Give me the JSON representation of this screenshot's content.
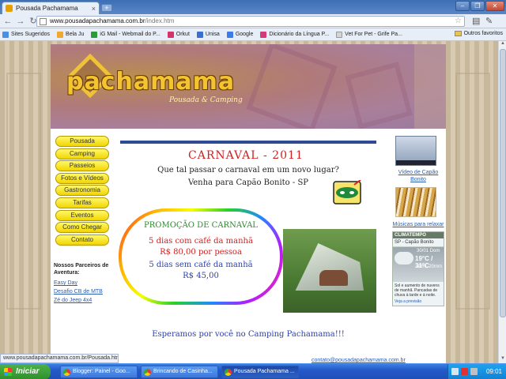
{
  "browser": {
    "tab_title": "Pousada Pachamama",
    "url_host": "www.pousadapachamama.com.br",
    "url_path": "/index.htm",
    "bookmarks": [
      {
        "label": "Sites Sugeridos",
        "color": "#4a8fe0"
      },
      {
        "label": "Bela Ju",
        "color": "#f0a830"
      },
      {
        "label": "iG Mail - Webmail do P...",
        "color": "#2a9a3a"
      },
      {
        "label": "Orkut",
        "color": "#d6336c"
      },
      {
        "label": "Unisa",
        "color": "#3a6fd0"
      },
      {
        "label": "Google",
        "color": "#3c7be8"
      },
      {
        "label": "Dicionário da Língua P...",
        "color": "#d43a7a"
      },
      {
        "label": "Vet For Pet - Grife Pa...",
        "color": "#d4d4d4"
      }
    ],
    "other_bookmarks": "Outros favoritos",
    "status_url": "www.pousadapachamama.com.br/Pousada.htm"
  },
  "site": {
    "logo": "pachamama",
    "logo_sub": "Pousada & Camping",
    "nav": [
      "Pousada",
      "Camping",
      "Passeios",
      "Fotos e Vídeos",
      "Gastronomia",
      "Tarifas",
      "Eventos",
      "Como Chegar",
      "Contato"
    ],
    "partners_heading": "Nossos Parceiros de Aventura:",
    "partners": [
      "Easy Day",
      "Desafio CB de MTB",
      "Zé do Jeep 4x4"
    ],
    "poster": {
      "title": "CARNAVAL - 2011",
      "line1": "Que tal passar o carnaval em um novo lugar?",
      "line2": "Venha para Capão Bonito - SP",
      "promo": "PROMOÇÃO DE CARNAVAL",
      "offer1": "5 dias com café da manhã",
      "price1": "R$ 80,00 por pessoa",
      "offer2": "5 dias sem café da manhã",
      "price2": "R$ 45,00",
      "bottom": "Esperamos por você no Camping Pachamama!!!"
    },
    "video_link": "Vídeo de Capão Bonito",
    "music_link": "Músicas para relaxar",
    "weather": {
      "header": "CLIMATEMPO",
      "city": "SP - Capão Bonito",
      "date": "30/01 Dom",
      "temp": "19°C / 31°C",
      "hum": "80%, 20mm",
      "desc": "Sol e aumento de nuvens de manhã. Pancadas de chuva à tarde e à noite.",
      "link": "Veja a previsão"
    },
    "footer_email": "contato@pousadapachamama.com.br"
  },
  "taskbar": {
    "start": "Iniciar",
    "tasks": [
      "Blogger: Painel - Goo...",
      "Brincando de Casinha...",
      "Pousada Pachamama ..."
    ],
    "clock": "09:01"
  }
}
